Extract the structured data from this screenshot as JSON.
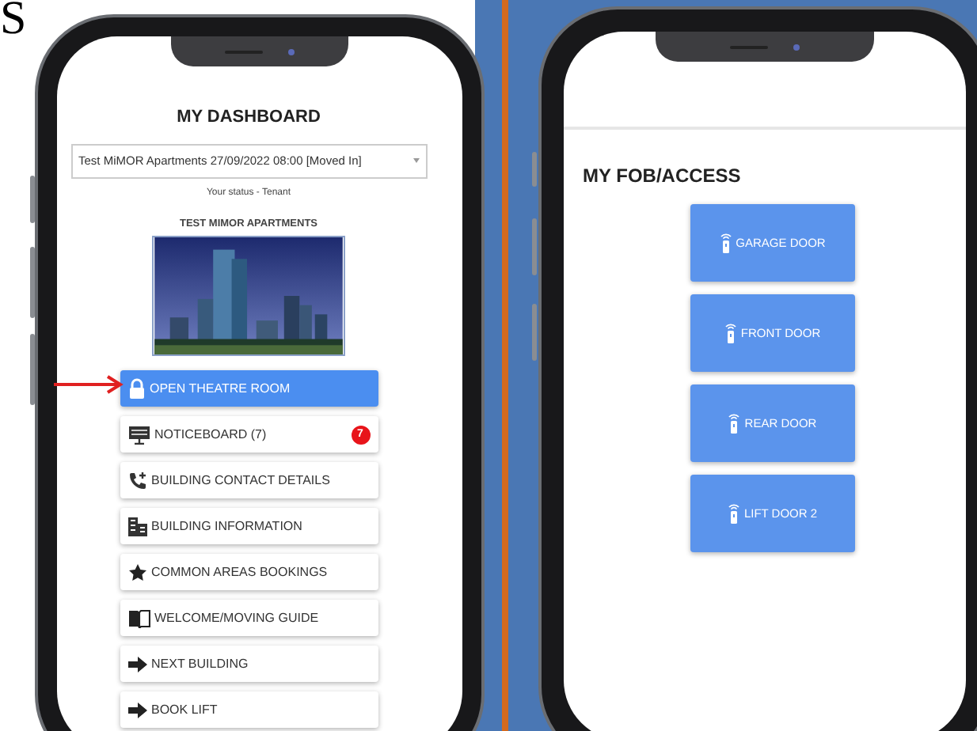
{
  "heading_fragment": "S",
  "dashboard": {
    "title": "MY DASHBOARD",
    "property_select": {
      "value": "Test MiMOR Apartments 27/09/2022 08:00 [Moved In]"
    },
    "status": "Your status - Tenant",
    "building_name": "TEST MIMOR APARTMENTS",
    "menu": [
      {
        "label": "OPEN THEATRE ROOM",
        "selected": true
      },
      {
        "label": "NOTICEBOARD (7)",
        "selected": false,
        "badge": "7"
      },
      {
        "label": "BUILDING CONTACT DETAILS",
        "selected": false
      },
      {
        "label": "BUILDING INFORMATION",
        "selected": false
      },
      {
        "label": "COMMON AREAS BOOKINGS",
        "selected": false
      },
      {
        "label": "WELCOME/MOVING GUIDE",
        "selected": false
      },
      {
        "label": "NEXT BUILDING",
        "selected": false
      },
      {
        "label": "BOOK LIFT",
        "selected": false
      }
    ]
  },
  "fob_access": {
    "title": "MY FOB/ACCESS",
    "doors": [
      {
        "label": "GARAGE DOOR"
      },
      {
        "label": "FRONT DOOR"
      },
      {
        "label": "REAR DOOR"
      },
      {
        "label": "LIFT DOOR 2"
      }
    ]
  }
}
